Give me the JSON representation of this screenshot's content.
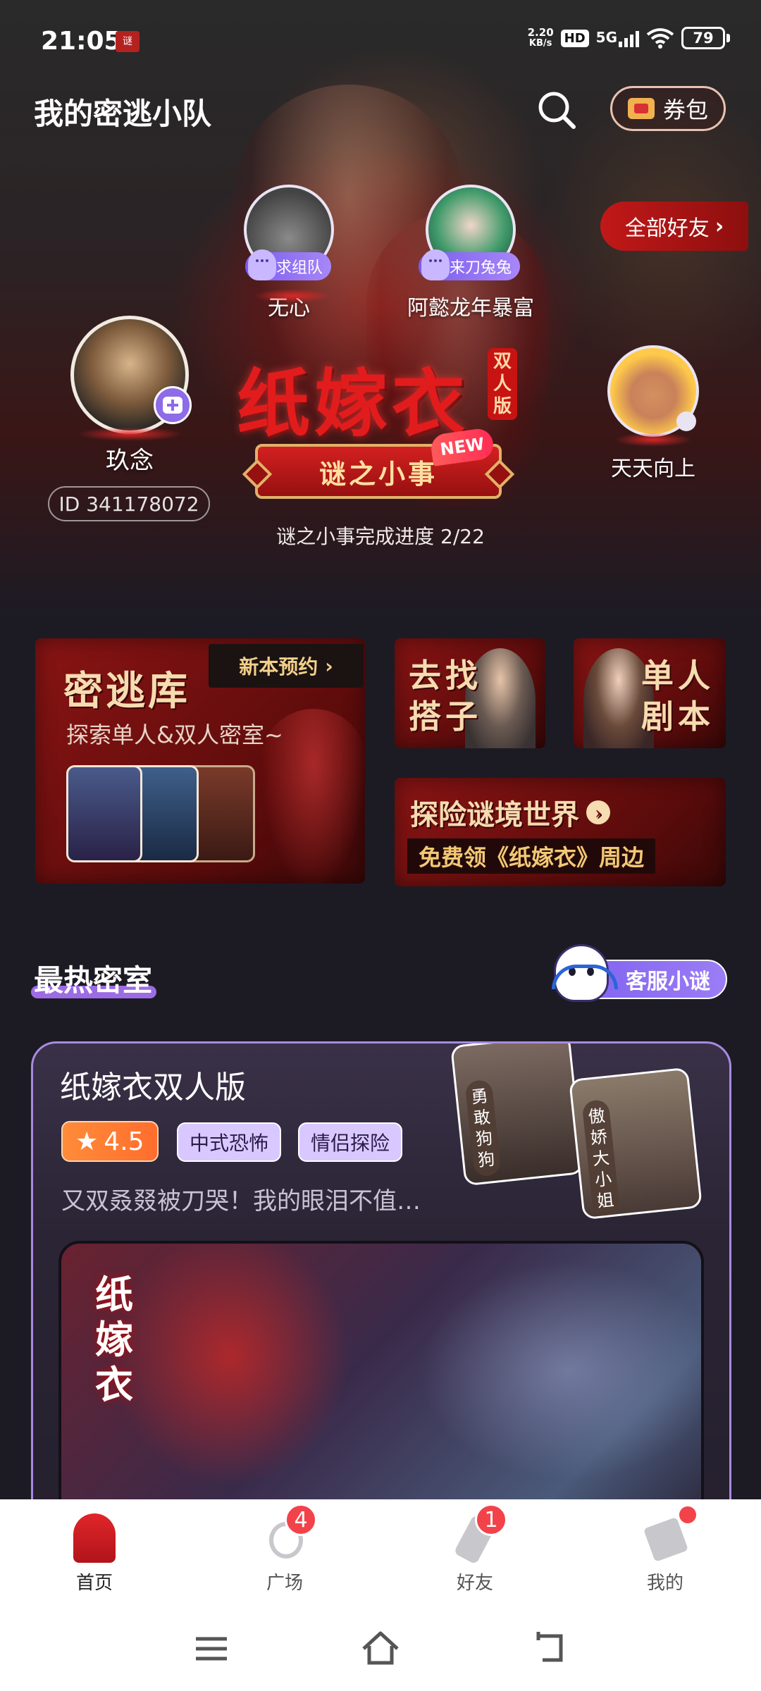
{
  "status_bar": {
    "time": "21:05",
    "net_speed_value": "2.20",
    "net_speed_unit": "KB/s",
    "hd": "HD",
    "network": "5G",
    "battery": "79"
  },
  "header": {
    "title": "我的密逃小队",
    "coupon_label": "券包",
    "all_friends_label": "全部好友"
  },
  "team": {
    "me": {
      "name": "玖念",
      "id_text": "ID 341178072"
    },
    "friends": [
      {
        "name": "无心",
        "status": "求组队"
      },
      {
        "name": "阿懿龙年暴富",
        "status": "来刀兔兔"
      },
      {
        "name": "天天向上"
      }
    ]
  },
  "featured": {
    "game_title": "纸嫁衣",
    "edition_badge": "双人版",
    "mystery_button": "谜之小事",
    "new_badge": "NEW",
    "progress_text": "谜之小事完成进度 2/22"
  },
  "entries": {
    "library": {
      "title": "密逃库",
      "subtitle": "探索单人&双人密室~",
      "new_book_label": "新本预约"
    },
    "find_partner": {
      "line1": "去找",
      "line2": "搭子"
    },
    "solo_script": {
      "line1": "单人",
      "line2": "剧本"
    },
    "explore": {
      "title": "探险谜境世界",
      "subtitle": "免费领《纸嫁衣》周边"
    }
  },
  "hot_rooms": {
    "section_title": "最热密室",
    "service_label": "客服小谜",
    "room": {
      "title": "纸嫁衣双人版",
      "rating": "4.5",
      "tags": [
        "中式恐怖",
        "情侣探险"
      ],
      "description": "又双叒叕被刀哭！我的眼泪不值…",
      "characters": [
        "勇敢狗狗",
        "傲娇大小姐"
      ],
      "banner_logo": "纸嫁衣"
    }
  },
  "tabbar": {
    "tabs": [
      {
        "label": "首页",
        "active": true
      },
      {
        "label": "广场",
        "badge": "4"
      },
      {
        "label": "好友",
        "badge": "1"
      },
      {
        "label": "我的",
        "dot": true
      }
    ]
  },
  "colors": {
    "accent_purple": "#9d6be6",
    "deep_red": "#8d0f0f",
    "badge_red": "#f2434a",
    "rating_orange": "#ff6d2d"
  }
}
